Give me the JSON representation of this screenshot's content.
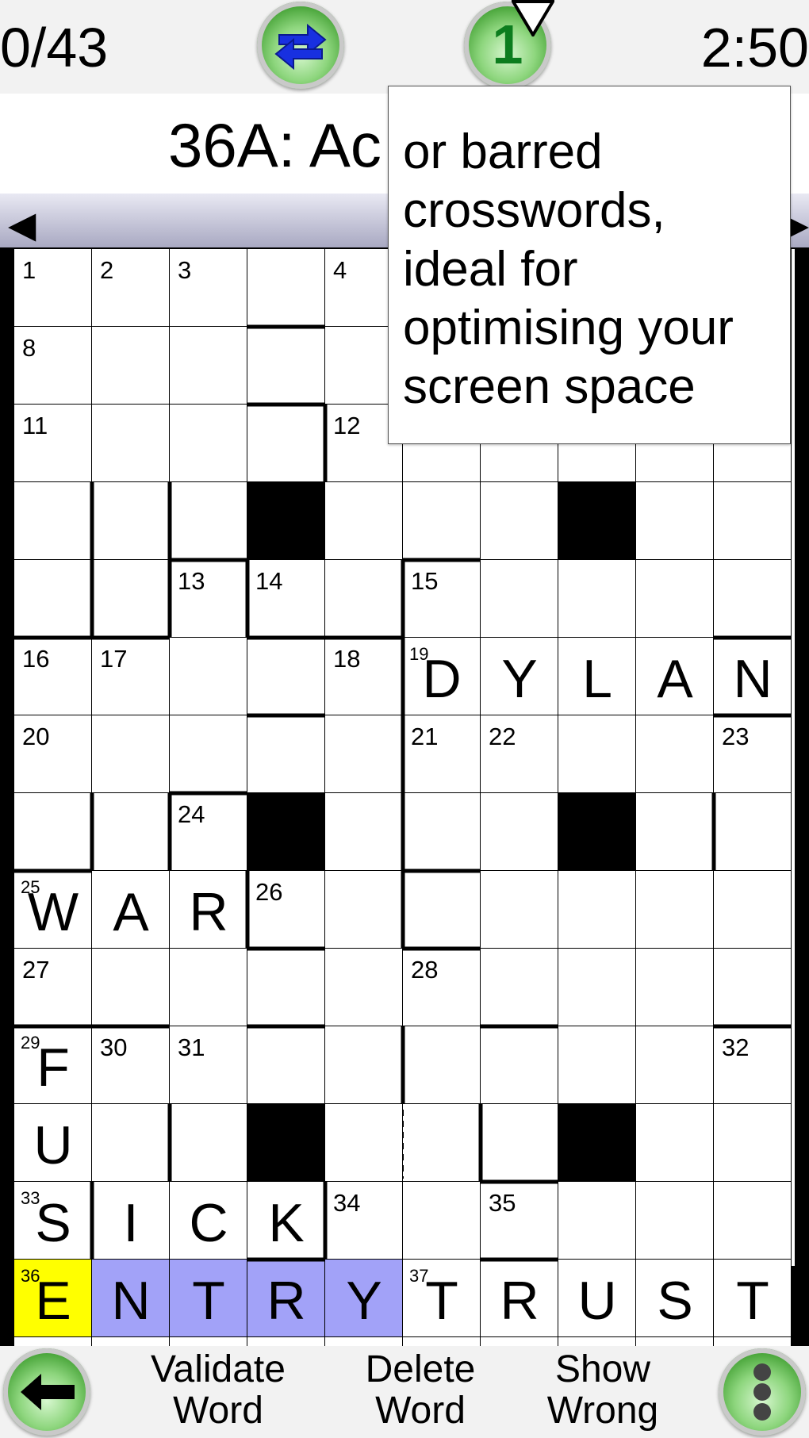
{
  "header": {
    "score": "0/43",
    "timer": "2:50",
    "level_button": "1"
  },
  "clue": {
    "text": "36A: Ac"
  },
  "tooltip": {
    "text": "or barred crosswords, ideal for optimising your screen space"
  },
  "toolbar": {
    "validate_line1": "Validate",
    "validate_line2": "Word",
    "delete_line1": "Delete",
    "delete_line2": "Word",
    "wrong_line1": "Show",
    "wrong_line2": "Wrong"
  },
  "colors": {
    "highlight_current": "#ffff00",
    "highlight_word": "#a2a2f8",
    "button_green": "#49a53a"
  },
  "grid": {
    "rows": 15,
    "cols": 10,
    "black_cells": [
      [
        3,
        3
      ],
      [
        3,
        7
      ],
      [
        7,
        3
      ],
      [
        7,
        7
      ],
      [
        11,
        3
      ],
      [
        11,
        7
      ]
    ],
    "numbers": [
      [
        0,
        0,
        "1"
      ],
      [
        0,
        1,
        "2"
      ],
      [
        0,
        2,
        "3"
      ],
      [
        0,
        4,
        "4"
      ],
      [
        1,
        0,
        "8"
      ],
      [
        2,
        0,
        "11"
      ],
      [
        2,
        4,
        "12"
      ],
      [
        4,
        2,
        "13"
      ],
      [
        4,
        3,
        "14"
      ],
      [
        4,
        5,
        "15"
      ],
      [
        5,
        0,
        "16"
      ],
      [
        5,
        1,
        "17"
      ],
      [
        5,
        4,
        "18"
      ],
      [
        5,
        5,
        "19"
      ],
      [
        6,
        0,
        "20"
      ],
      [
        6,
        5,
        "21"
      ],
      [
        6,
        6,
        "22"
      ],
      [
        6,
        9,
        "23"
      ],
      [
        7,
        2,
        "24"
      ],
      [
        8,
        0,
        "25"
      ],
      [
        8,
        3,
        "26"
      ],
      [
        9,
        0,
        "27"
      ],
      [
        9,
        5,
        "28"
      ],
      [
        10,
        0,
        "29"
      ],
      [
        10,
        1,
        "30"
      ],
      [
        10,
        2,
        "31"
      ],
      [
        10,
        9,
        "32"
      ],
      [
        12,
        0,
        "33"
      ],
      [
        12,
        4,
        "34"
      ],
      [
        12,
        6,
        "35"
      ],
      [
        13,
        0,
        "36"
      ],
      [
        13,
        5,
        "37"
      ]
    ],
    "letters": [
      [
        5,
        5,
        "D"
      ],
      [
        5,
        6,
        "Y"
      ],
      [
        5,
        7,
        "L"
      ],
      [
        5,
        8,
        "A"
      ],
      [
        5,
        9,
        "N"
      ],
      [
        8,
        0,
        "W"
      ],
      [
        8,
        1,
        "A"
      ],
      [
        8,
        2,
        "R"
      ],
      [
        10,
        0,
        "F"
      ],
      [
        11,
        0,
        "U"
      ],
      [
        12,
        0,
        "S"
      ],
      [
        12,
        1,
        "I"
      ],
      [
        12,
        2,
        "C"
      ],
      [
        12,
        3,
        "K"
      ],
      [
        13,
        0,
        "E"
      ],
      [
        13,
        1,
        "N"
      ],
      [
        13,
        2,
        "T"
      ],
      [
        13,
        3,
        "R"
      ],
      [
        13,
        4,
        "Y"
      ],
      [
        13,
        5,
        "T"
      ],
      [
        13,
        6,
        "R"
      ],
      [
        13,
        7,
        "U"
      ],
      [
        13,
        8,
        "S"
      ],
      [
        13,
        9,
        "T"
      ]
    ],
    "current_cell": [
      13,
      0
    ],
    "word_cells": [
      [
        13,
        1
      ],
      [
        13,
        2
      ],
      [
        13,
        3
      ],
      [
        13,
        4
      ]
    ]
  }
}
